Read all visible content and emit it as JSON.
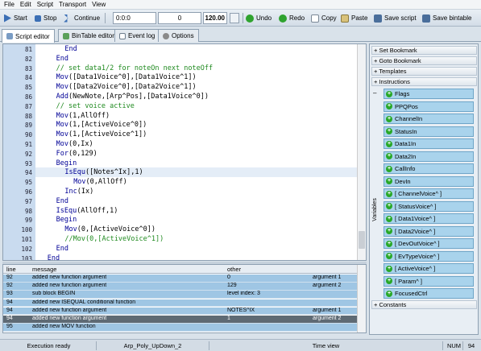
{
  "menu": [
    "File",
    "Edit",
    "Script",
    "Transport",
    "View"
  ],
  "toolbar": {
    "start": "Start",
    "stop": "Stop",
    "continue": "Continue",
    "position": "0:0:0",
    "ticks": "0",
    "tempo": "120.00",
    "undo": "Undo",
    "redo": "Redo",
    "copy": "Copy",
    "paste": "Paste",
    "save_script": "Save script",
    "save_bintable": "Save bintable"
  },
  "tabs": [
    "Script editor",
    "BinTable editor",
    "Event log",
    "Options"
  ],
  "code": [
    {
      "n": "81",
      "indent": 6,
      "parts": [
        {
          "t": "End",
          "c": "kw"
        }
      ]
    },
    {
      "n": "82",
      "indent": 4,
      "parts": [
        {
          "t": "End",
          "c": "kw"
        }
      ]
    },
    {
      "n": "83",
      "indent": 4,
      "parts": [
        {
          "t": "// set data1/2 for noteOn next noteOff",
          "c": "cm"
        }
      ]
    },
    {
      "n": "84",
      "indent": 4,
      "parts": [
        {
          "t": "Mov",
          "c": "kw"
        },
        {
          "t": "([Data1Voice^0],[Data1Voice^1])",
          "c": ""
        }
      ]
    },
    {
      "n": "85",
      "indent": 4,
      "parts": [
        {
          "t": "Mov",
          "c": "kw"
        },
        {
          "t": "([Data2Voice^0],[Data2Voice^1])",
          "c": ""
        }
      ]
    },
    {
      "n": "86",
      "indent": 4,
      "parts": [
        {
          "t": "Add",
          "c": "kw"
        },
        {
          "t": "(NewNote,[Arp^Pos],[Data1Voice^0])",
          "c": ""
        }
      ]
    },
    {
      "n": "87",
      "indent": 4,
      "parts": [
        {
          "t": "// set voice active",
          "c": "cm"
        }
      ]
    },
    {
      "n": "88",
      "indent": 4,
      "parts": [
        {
          "t": "Mov",
          "c": "kw"
        },
        {
          "t": "(1,AllOff)",
          "c": ""
        }
      ]
    },
    {
      "n": "89",
      "indent": 4,
      "parts": [
        {
          "t": "Mov",
          "c": "kw"
        },
        {
          "t": "(1,[ActiveVoice^0])",
          "c": ""
        }
      ]
    },
    {
      "n": "90",
      "indent": 4,
      "parts": [
        {
          "t": "Mov",
          "c": "kw"
        },
        {
          "t": "(1,[ActiveVoice^1])",
          "c": ""
        }
      ]
    },
    {
      "n": "91",
      "indent": 4,
      "parts": [
        {
          "t": "Mov",
          "c": "kw"
        },
        {
          "t": "(0,Ix)",
          "c": ""
        }
      ]
    },
    {
      "n": "92",
      "indent": 4,
      "parts": [
        {
          "t": "For",
          "c": "kw"
        },
        {
          "t": "(0,129)",
          "c": ""
        }
      ]
    },
    {
      "n": "93",
      "indent": 4,
      "parts": [
        {
          "t": "Begin",
          "c": "kw"
        }
      ]
    },
    {
      "n": "94",
      "indent": 6,
      "hl": true,
      "parts": [
        {
          "t": "IsEqu",
          "c": "kw"
        },
        {
          "t": "([Notes^Ix],1)",
          "c": ""
        }
      ]
    },
    {
      "n": "95",
      "indent": 8,
      "parts": [
        {
          "t": "Mov",
          "c": "kw"
        },
        {
          "t": "(0,AllOff)",
          "c": ""
        }
      ]
    },
    {
      "n": "96",
      "indent": 6,
      "parts": [
        {
          "t": "Inc",
          "c": "kw"
        },
        {
          "t": "(Ix)",
          "c": ""
        }
      ]
    },
    {
      "n": "97",
      "indent": 4,
      "parts": [
        {
          "t": "End",
          "c": "kw"
        }
      ]
    },
    {
      "n": "98",
      "indent": 4,
      "parts": [
        {
          "t": "IsEqu",
          "c": "kw"
        },
        {
          "t": "(AllOff,1)",
          "c": ""
        }
      ]
    },
    {
      "n": "99",
      "indent": 4,
      "parts": [
        {
          "t": "Begin",
          "c": "kw"
        }
      ]
    },
    {
      "n": "100",
      "indent": 6,
      "parts": [
        {
          "t": "Mov",
          "c": "kw"
        },
        {
          "t": "(0,[ActiveVoice^0])",
          "c": ""
        }
      ]
    },
    {
      "n": "101",
      "indent": 6,
      "parts": [
        {
          "t": "//Mov(0,[ActiveVoice^1])",
          "c": "cm"
        }
      ]
    },
    {
      "n": "102",
      "indent": 4,
      "parts": [
        {
          "t": "End",
          "c": "kw"
        }
      ]
    },
    {
      "n": "103",
      "indent": 2,
      "parts": [
        {
          "t": "End",
          "c": "kw"
        }
      ]
    }
  ],
  "log": {
    "headers": [
      "line",
      "message",
      "other",
      ""
    ],
    "rows": [
      [
        "92",
        "added new function argument",
        "0",
        "argument 1"
      ],
      [
        "92",
        "added new function argument",
        "129",
        "argument 2"
      ],
      [
        "93",
        "sub block BEGIN",
        "level index: 3",
        ""
      ],
      [
        "94",
        "added new ISEQUAL conditional function",
        "",
        ""
      ],
      [
        "94",
        "added new function argument",
        "NOTES^IX",
        "argument 1"
      ],
      [
        "94",
        "added new function argument",
        "1",
        "argument 2"
      ],
      [
        "95",
        "added new MOV function",
        "",
        ""
      ]
    ],
    "selected_row": 5
  },
  "panel": {
    "top_sections": [
      "Set Bookmark",
      "Goto Bookmark",
      "Templates",
      "Instructions"
    ],
    "variables_label": "Variables",
    "variables": [
      "Flags",
      "PPQPos",
      "ChannelIn",
      "StatusIn",
      "Data1In",
      "Data2In",
      "CallInfo",
      "DevIn",
      "[ ChannelVoice^ ]",
      "[ StatusVoice^ ]",
      "[ Data1Voice^ ]",
      "[ Data2Voice^ ]",
      "[ DevOutVoice^ ]",
      "[ EvTypeVoice^ ]",
      "[ ActiveVoice^ ]",
      "[ Param^ ]",
      "FocusedCtrl"
    ],
    "bottom_section": "Constants"
  },
  "status": {
    "state": "Execution ready",
    "file": "Arp_Poly_UpDown_2",
    "view": "Time view",
    "num": "NUM",
    "line": "94"
  }
}
